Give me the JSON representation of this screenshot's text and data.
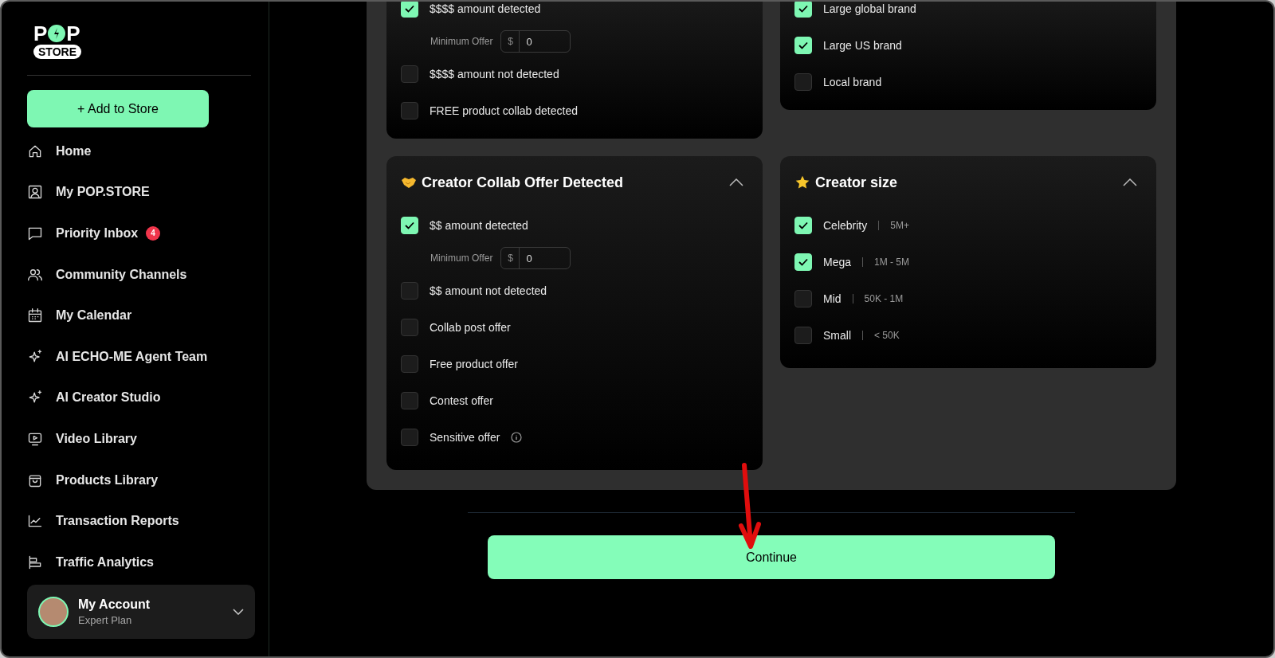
{
  "logo": {
    "left_letter": "P",
    "right_letter": "P",
    "badge": "STORE"
  },
  "add_button": "+ Add to Store",
  "nav": [
    {
      "label": "Home",
      "selected": false
    },
    {
      "label": "My POP.STORE",
      "selected": false
    },
    {
      "label": "Priority Inbox",
      "badge": "4",
      "selected": false
    },
    {
      "label": "Community Channels",
      "selected": false
    },
    {
      "label": "My Calendar",
      "selected": false
    },
    {
      "label": "AI ECHO-ME Agent Team",
      "selected": false
    },
    {
      "label": "AI Creator Studio",
      "selected": false
    },
    {
      "label": "Video Library",
      "selected": false
    },
    {
      "label": "Products Library",
      "selected": false
    },
    {
      "label": "Transaction Reports",
      "selected": false
    },
    {
      "label": "Traffic Analytics",
      "selected": false
    }
  ],
  "account": {
    "name": "My Account",
    "plan": "Expert Plan"
  },
  "columns": [
    [
      {
        "options": [
          {
            "kind": "check",
            "label": "$$$$ amount detected",
            "checked": true
          },
          {
            "kind": "amount",
            "label": "Minimum Offer",
            "currency": "$",
            "value": "0"
          },
          {
            "kind": "check",
            "label": "$$$$ amount not detected",
            "checked": false
          },
          {
            "kind": "check",
            "label": "FREE product collab detected",
            "checked": false
          }
        ]
      },
      {
        "title": "Creator Collab Offer Detected",
        "expanded": true,
        "options": [
          {
            "kind": "check",
            "label": "$$ amount detected",
            "checked": true
          },
          {
            "kind": "amount",
            "label": "Minimum Offer",
            "currency": "$",
            "value": "0"
          },
          {
            "kind": "check",
            "label": "$$ amount not detected",
            "checked": false
          },
          {
            "kind": "check",
            "label": "Collab post offer",
            "checked": false
          },
          {
            "kind": "check",
            "label": "Free product offer",
            "checked": false
          },
          {
            "kind": "check",
            "label": "Contest offer",
            "checked": false
          },
          {
            "kind": "check",
            "label": "Sensitive offer",
            "checked": false,
            "info": true
          }
        ]
      }
    ],
    [
      {
        "options": [
          {
            "kind": "check",
            "label": "Large global brand",
            "checked": true
          },
          {
            "kind": "check",
            "label": "Large US brand",
            "checked": true
          },
          {
            "kind": "check",
            "label": "Local brand",
            "checked": false
          }
        ]
      },
      {
        "title": "Creator size",
        "expanded": true,
        "options": [
          {
            "kind": "check",
            "label": "Celebrity",
            "detail": "5M+",
            "checked": true
          },
          {
            "kind": "check",
            "label": "Mega",
            "detail": "1M - 5M",
            "checked": true
          },
          {
            "kind": "check",
            "label": "Mid",
            "detail": "50K - 1M",
            "checked": false
          },
          {
            "kind": "check",
            "label": "Small",
            "detail": "< 50K",
            "checked": false
          }
        ]
      }
    ]
  ],
  "continue_button": "Continue"
}
